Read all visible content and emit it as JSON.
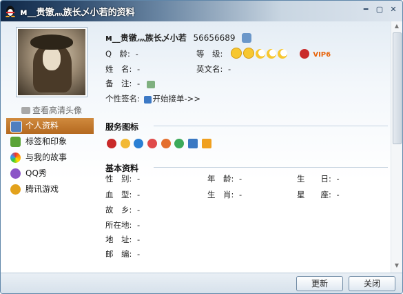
{
  "window": {
    "title": "м__贵镦灬族长乄小若的资料",
    "controls": [
      "min",
      "max",
      "close"
    ]
  },
  "sidebar": {
    "hd_avatar_label": "查看高清头像",
    "items": [
      {
        "label": "个人资料",
        "icon": "profile-card-icon",
        "selected": true,
        "color": "#4f7fbf"
      },
      {
        "label": "标签和印象",
        "icon": "tag-icon",
        "selected": false,
        "color": "#5aa336"
      },
      {
        "label": "与我的故事",
        "icon": "rainbow-icon",
        "selected": false,
        "color": "#d8622b"
      },
      {
        "label": "QQ秀",
        "icon": "qqshow-icon",
        "selected": false,
        "color": "#8b55c7"
      },
      {
        "label": "腾讯游戏",
        "icon": "game-icon",
        "selected": false,
        "color": "#e3a21c"
      }
    ]
  },
  "profile": {
    "nickname": "м__贵镦灬族长乄小若",
    "qq_number": "56656689",
    "q_age_label": "Q　龄:",
    "q_age_value": "-",
    "level_label": "等　级:",
    "vip_label": "VIP6",
    "name_label": "姓　名:",
    "name_value": "-",
    "english_name_label": "英文名:",
    "english_name_value": "-",
    "remark_label": "备　注:",
    "remark_value": "-",
    "signature_label": "个性签名:",
    "signature_value": "开始接单->>"
  },
  "service_icons": {
    "title": "服务图标",
    "icons": [
      "qq-penguin-icon",
      "smiley-icon",
      "qq-plus-icon",
      "heart-icon",
      "heart-icon-2",
      "diamond-icon",
      "phone-icon",
      "book-icon"
    ]
  },
  "basic_info": {
    "title": "基本资料",
    "fields": [
      {
        "label": "性　别:",
        "value": "-"
      },
      {
        "label": "年　龄:",
        "value": "-"
      },
      {
        "label": "生　　日:",
        "value": "-"
      },
      {
        "label": "血　型:",
        "value": "-"
      },
      {
        "label": "生　肖:",
        "value": "-"
      },
      {
        "label": "星　　座:",
        "value": "-"
      },
      {
        "label": "故　乡:",
        "value": "-"
      },
      {
        "label": "所在地:",
        "value": "-"
      },
      {
        "label": "地　址:",
        "value": "-"
      },
      {
        "label": "邮　编:",
        "value": "-"
      }
    ]
  },
  "buttons": {
    "refresh": "更新",
    "close": "关闭"
  },
  "colors": {
    "selected_nav": "#c27a2f",
    "title_dark": "#0f2746",
    "vip": "#e8650c"
  }
}
